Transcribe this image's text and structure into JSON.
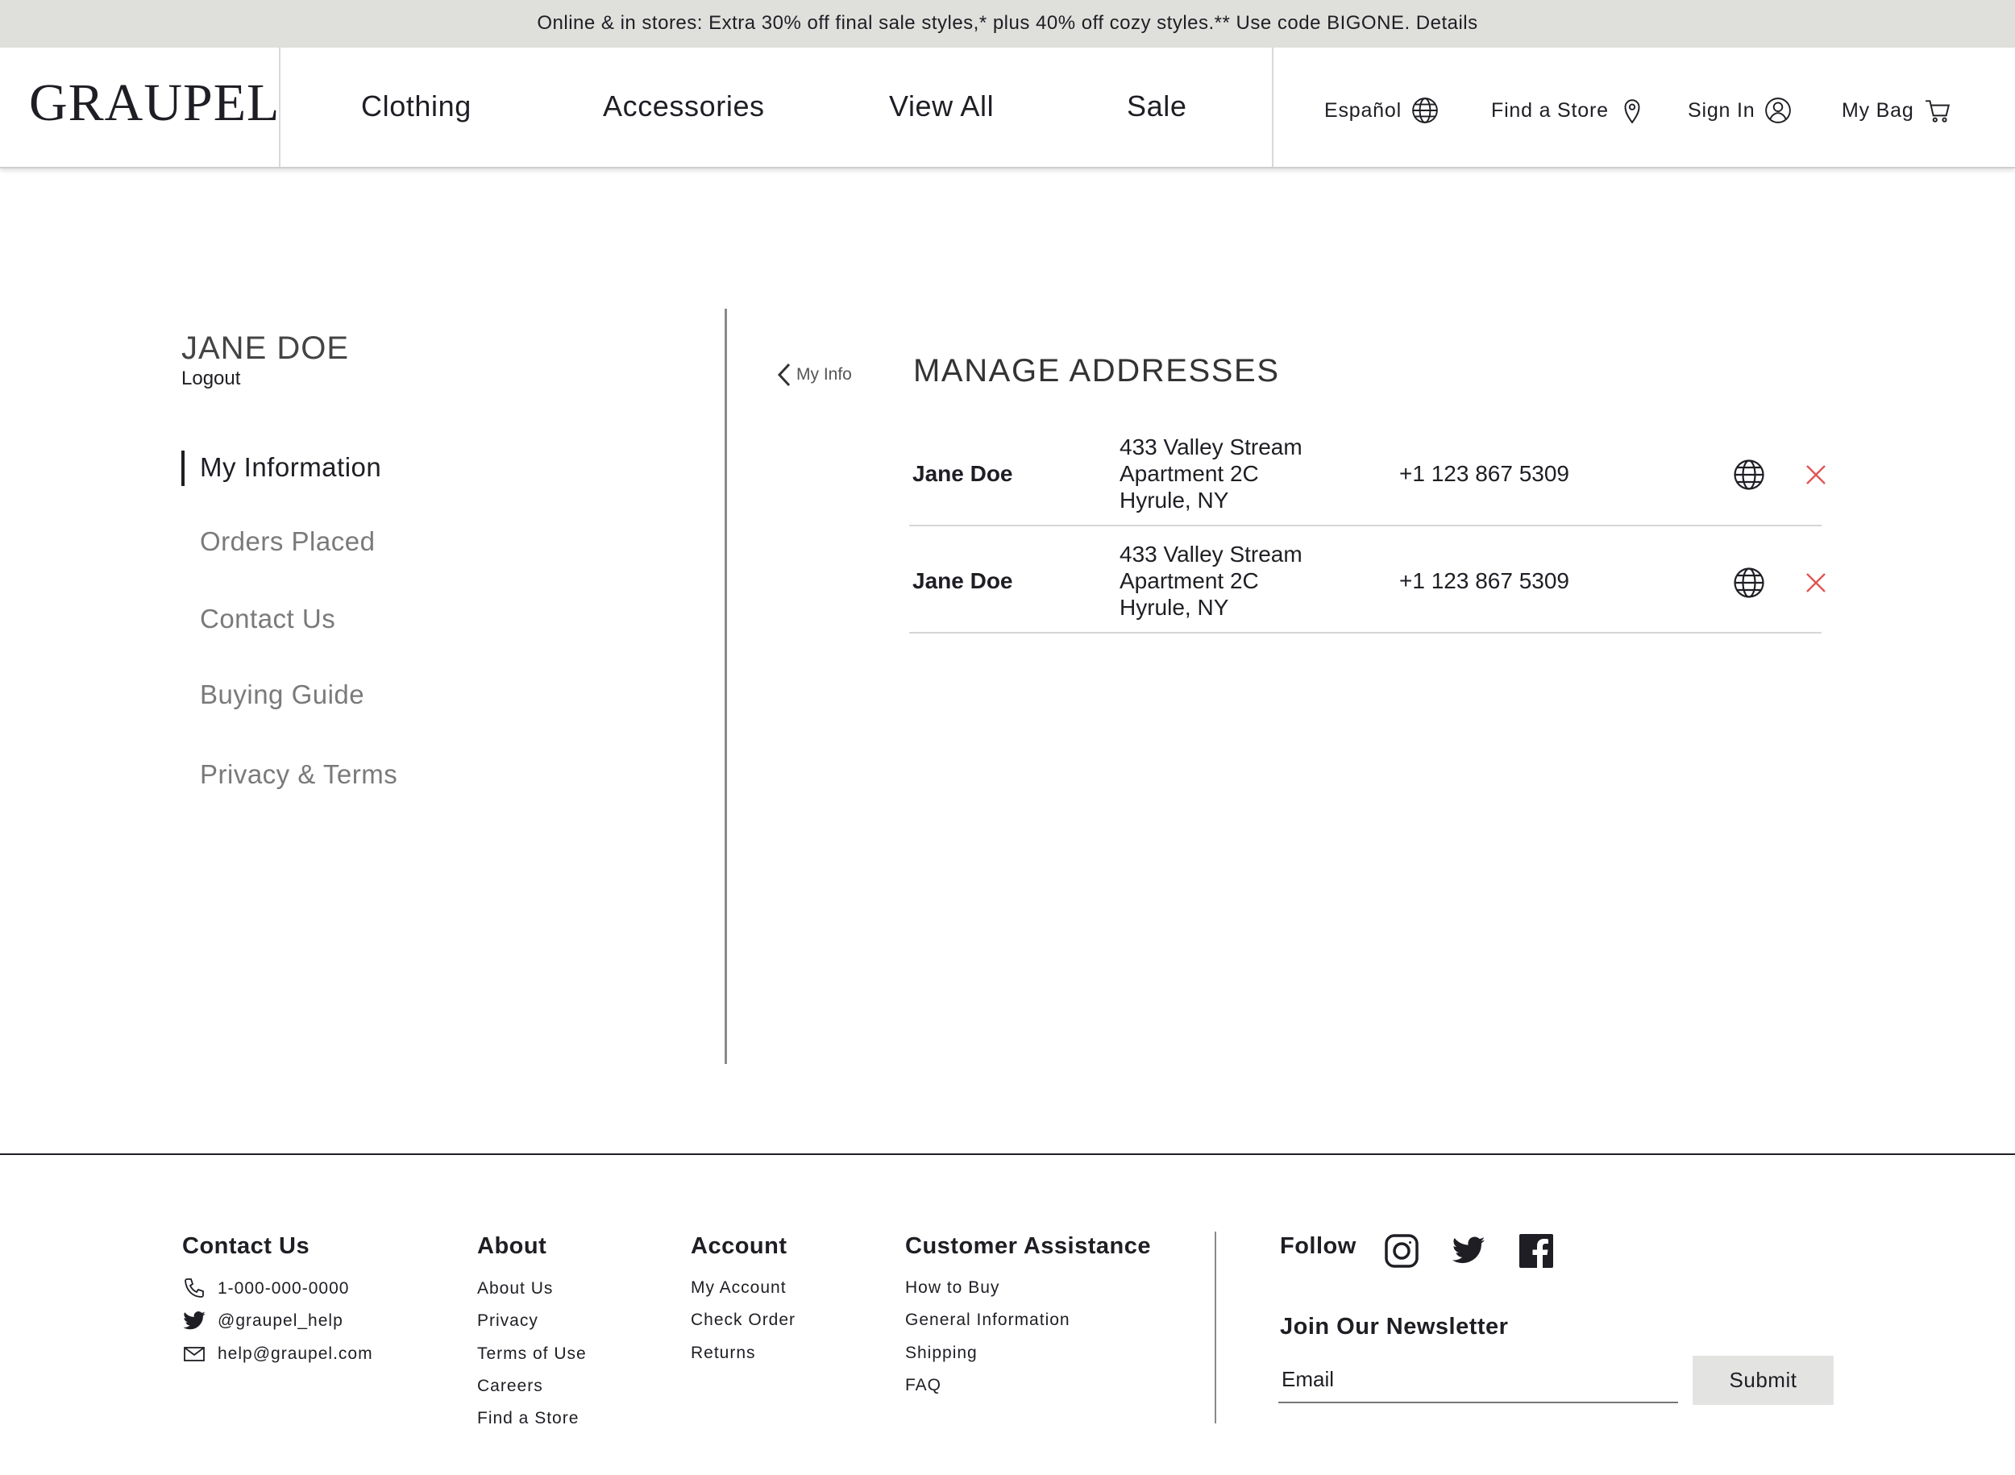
{
  "promo": {
    "text": "Online & in stores: Extra 30% off final sale styles,* plus 40% off cozy styles.** Use code BIGONE. Details"
  },
  "header": {
    "logo": "GRAUPEL",
    "nav": [
      "Clothing",
      "Accessories",
      "View All",
      "Sale"
    ],
    "utilities": {
      "language": "Español",
      "find_store": "Find a Store",
      "sign_in": "Sign In",
      "bag": "My Bag"
    }
  },
  "account": {
    "user_name": "JANE DOE",
    "logout": "Logout",
    "menu": [
      {
        "label": "My Information",
        "active": true
      },
      {
        "label": "Orders Placed",
        "active": false
      },
      {
        "label": "Contact Us",
        "active": false
      },
      {
        "label": "Buying Guide",
        "active": false
      },
      {
        "label": "Privacy & Terms",
        "active": false
      }
    ]
  },
  "main": {
    "back_label": "My Info",
    "title": "MANAGE ADDRESSES",
    "addresses": [
      {
        "name": "Jane Doe",
        "line1": "433 Valley Stream",
        "line2": "Apartment 2C",
        "line3": "Hyrule, NY",
        "phone": "+1 123 867 5309"
      },
      {
        "name": "Jane Doe",
        "line1": "433 Valley Stream",
        "line2": "Apartment 2C",
        "line3": "Hyrule, NY",
        "phone": "+1 123 867 5309"
      }
    ]
  },
  "footer": {
    "contact": {
      "heading": "Contact Us",
      "phone": "1-000-000-0000",
      "twitter": "@graupel_help",
      "email": "help@graupel.com"
    },
    "about": {
      "heading": "About",
      "links": [
        "About Us",
        "Privacy",
        "Terms of Use",
        "Careers",
        "Find a Store"
      ]
    },
    "account": {
      "heading": "Account",
      "links": [
        "My Account",
        "Check Order",
        "Returns"
      ]
    },
    "assistance": {
      "heading": "Customer Assistance",
      "links": [
        "How to Buy",
        "General Information",
        "Shipping",
        "FAQ"
      ]
    },
    "follow": {
      "heading": "Follow"
    },
    "newsletter": {
      "heading": "Join Our Newsletter",
      "placeholder": "Email",
      "submit": "Submit"
    }
  },
  "colors": {
    "promo_bg": "#dfe0dc",
    "text": "#1e1e24",
    "muted": "#7a7a7a",
    "remove_icon": "#e05555",
    "button_bg": "#e3e4e2"
  },
  "icons": {
    "language": "globe-icon",
    "store": "map-pin-icon",
    "account": "user-circle-icon",
    "bag": "cart-icon",
    "address_action": "globe-icon",
    "remove": "close-icon",
    "phone": "phone-icon",
    "twitter": "twitter-icon",
    "email": "mail-icon",
    "social": [
      "instagram-icon",
      "twitter-icon",
      "facebook-icon"
    ]
  }
}
